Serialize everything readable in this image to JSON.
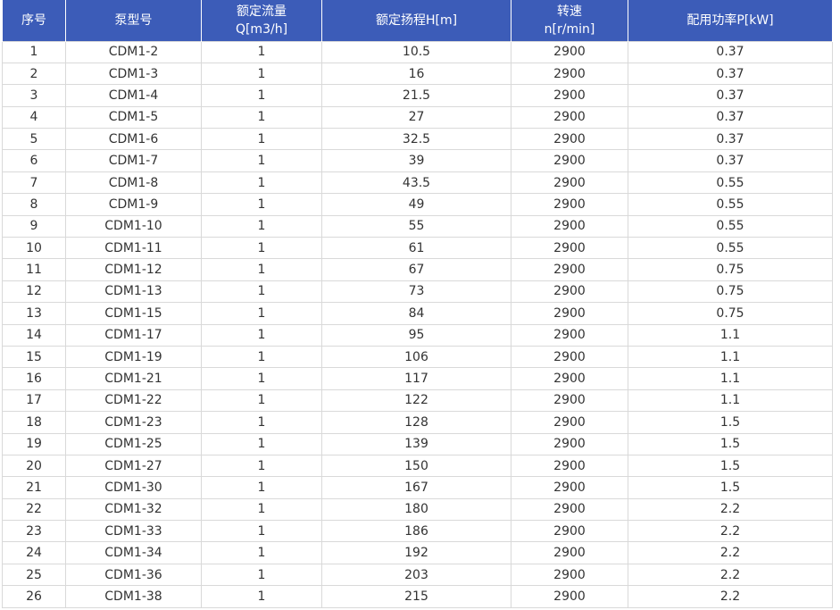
{
  "table": {
    "headers": [
      {
        "lines": [
          "序号"
        ]
      },
      {
        "lines": [
          "泵型号"
        ]
      },
      {
        "lines": [
          "额定流量",
          "Q[m3/h]"
        ]
      },
      {
        "lines": [
          "额定扬程H[m]"
        ]
      },
      {
        "lines": [
          "转速",
          "n[r/min]"
        ]
      },
      {
        "lines": [
          "配用功率P[kW]"
        ]
      }
    ],
    "rows": [
      [
        "1",
        "CDM1-2",
        "1",
        "10.5",
        "2900",
        "0.37"
      ],
      [
        "2",
        "CDM1-3",
        "1",
        "16",
        "2900",
        "0.37"
      ],
      [
        "3",
        "CDM1-4",
        "1",
        "21.5",
        "2900",
        "0.37"
      ],
      [
        "4",
        "CDM1-5",
        "1",
        "27",
        "2900",
        "0.37"
      ],
      [
        "5",
        "CDM1-6",
        "1",
        "32.5",
        "2900",
        "0.37"
      ],
      [
        "6",
        "CDM1-7",
        "1",
        "39",
        "2900",
        "0.37"
      ],
      [
        "7",
        "CDM1-8",
        "1",
        "43.5",
        "2900",
        "0.55"
      ],
      [
        "8",
        "CDM1-9",
        "1",
        "49",
        "2900",
        "0.55"
      ],
      [
        "9",
        "CDM1-10",
        "1",
        "55",
        "2900",
        "0.55"
      ],
      [
        "10",
        "CDM1-11",
        "1",
        "61",
        "2900",
        "0.55"
      ],
      [
        "11",
        "CDM1-12",
        "1",
        "67",
        "2900",
        "0.75"
      ],
      [
        "12",
        "CDM1-13",
        "1",
        "73",
        "2900",
        "0.75"
      ],
      [
        "13",
        "CDM1-15",
        "1",
        "84",
        "2900",
        "0.75"
      ],
      [
        "14",
        "CDM1-17",
        "1",
        "95",
        "2900",
        "1.1"
      ],
      [
        "15",
        "CDM1-19",
        "1",
        "106",
        "2900",
        "1.1"
      ],
      [
        "16",
        "CDM1-21",
        "1",
        "117",
        "2900",
        "1.1"
      ],
      [
        "17",
        "CDM1-22",
        "1",
        "122",
        "2900",
        "1.1"
      ],
      [
        "18",
        "CDM1-23",
        "1",
        "128",
        "2900",
        "1.5"
      ],
      [
        "19",
        "CDM1-25",
        "1",
        "139",
        "2900",
        "1.5"
      ],
      [
        "20",
        "CDM1-27",
        "1",
        "150",
        "2900",
        "1.5"
      ],
      [
        "21",
        "CDM1-30",
        "1",
        "167",
        "2900",
        "1.5"
      ],
      [
        "22",
        "CDM1-32",
        "1",
        "180",
        "2900",
        "2.2"
      ],
      [
        "23",
        "CDM1-33",
        "1",
        "186",
        "2900",
        "2.2"
      ],
      [
        "24",
        "CDM1-34",
        "1",
        "192",
        "2900",
        "2.2"
      ],
      [
        "25",
        "CDM1-36",
        "1",
        "203",
        "2900",
        "2.2"
      ],
      [
        "26",
        "CDM1-38",
        "1",
        "215",
        "2900",
        "2.2"
      ]
    ]
  },
  "colors": {
    "header_bg": "#3c5cb8",
    "header_text": "#ffffff",
    "cell_text": "#333333",
    "grid": "#d9d9d9"
  }
}
